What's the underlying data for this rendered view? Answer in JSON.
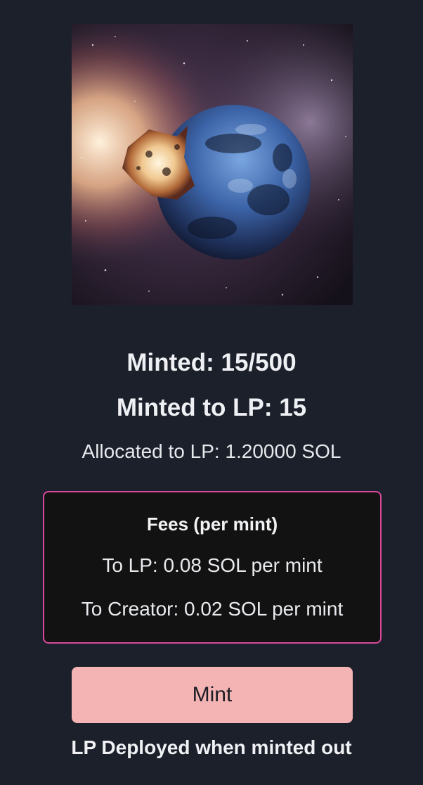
{
  "nft": {
    "image_alt": "planet-explosion-artwork"
  },
  "stats": {
    "minted": "Minted: 15/500",
    "minted_to_lp": "Minted to LP: 15",
    "allocated_to_lp": "Allocated to LP: 1.20000 SOL"
  },
  "fees": {
    "title": "Fees (per mint)",
    "to_lp": "To LP: 0.08 SOL per mint",
    "to_creator": "To Creator: 0.02 SOL per mint"
  },
  "actions": {
    "mint_label": "Mint"
  },
  "footer": {
    "note": "LP Deployed when minted out"
  },
  "colors": {
    "background": "#1c202b",
    "fees_border": "#d8489a",
    "fees_bg": "#121212",
    "mint_button": "#f4b4b4"
  }
}
